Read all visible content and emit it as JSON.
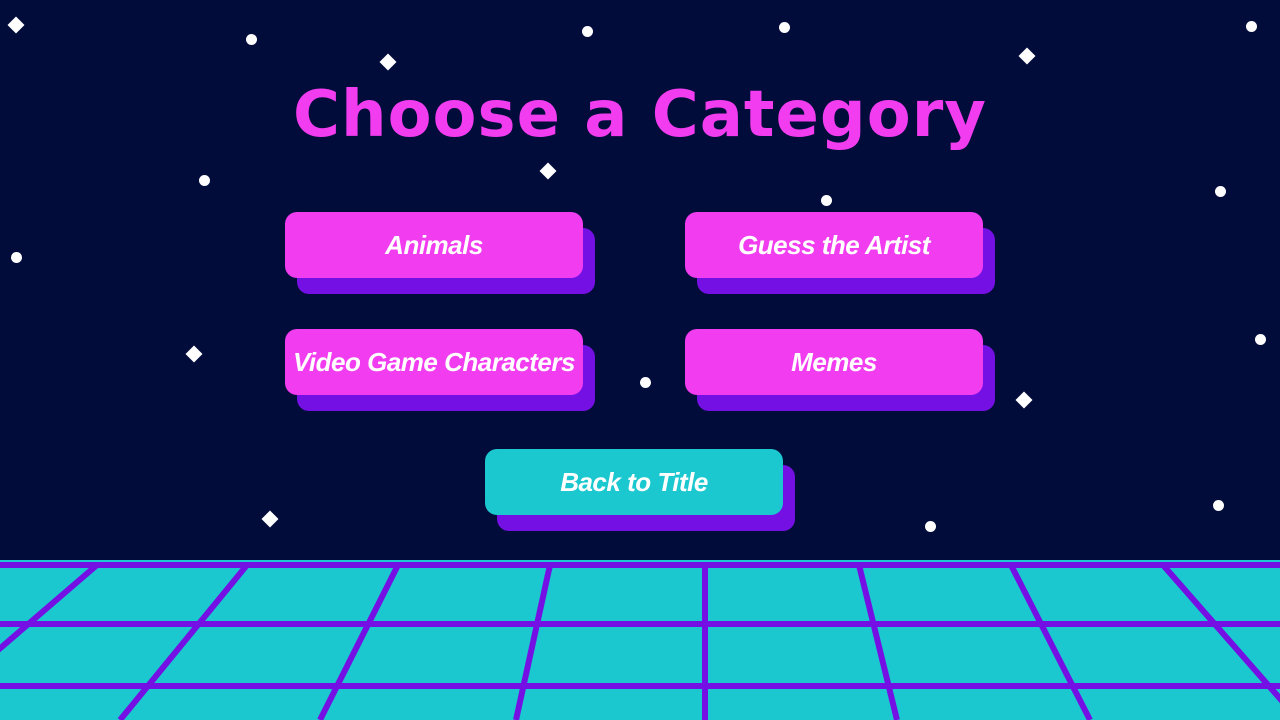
{
  "screen": {
    "title": "Choose a Category"
  },
  "categories": [
    {
      "label": "Animals"
    },
    {
      "label": "Guess the Artist"
    },
    {
      "label": "Video Game Characters"
    },
    {
      "label": "Memes"
    }
  ],
  "back_button": {
    "label": "Back to Title"
  },
  "colors": {
    "background": "#020c3a",
    "title_pink": "#f13cf0",
    "button_pink": "#f13cf0",
    "button_teal": "#1cc8cf",
    "button_shadow": "#7410e4",
    "floor_teal": "#1cc8cf",
    "grid_line": "#7410e4",
    "star": "#ffffff"
  }
}
